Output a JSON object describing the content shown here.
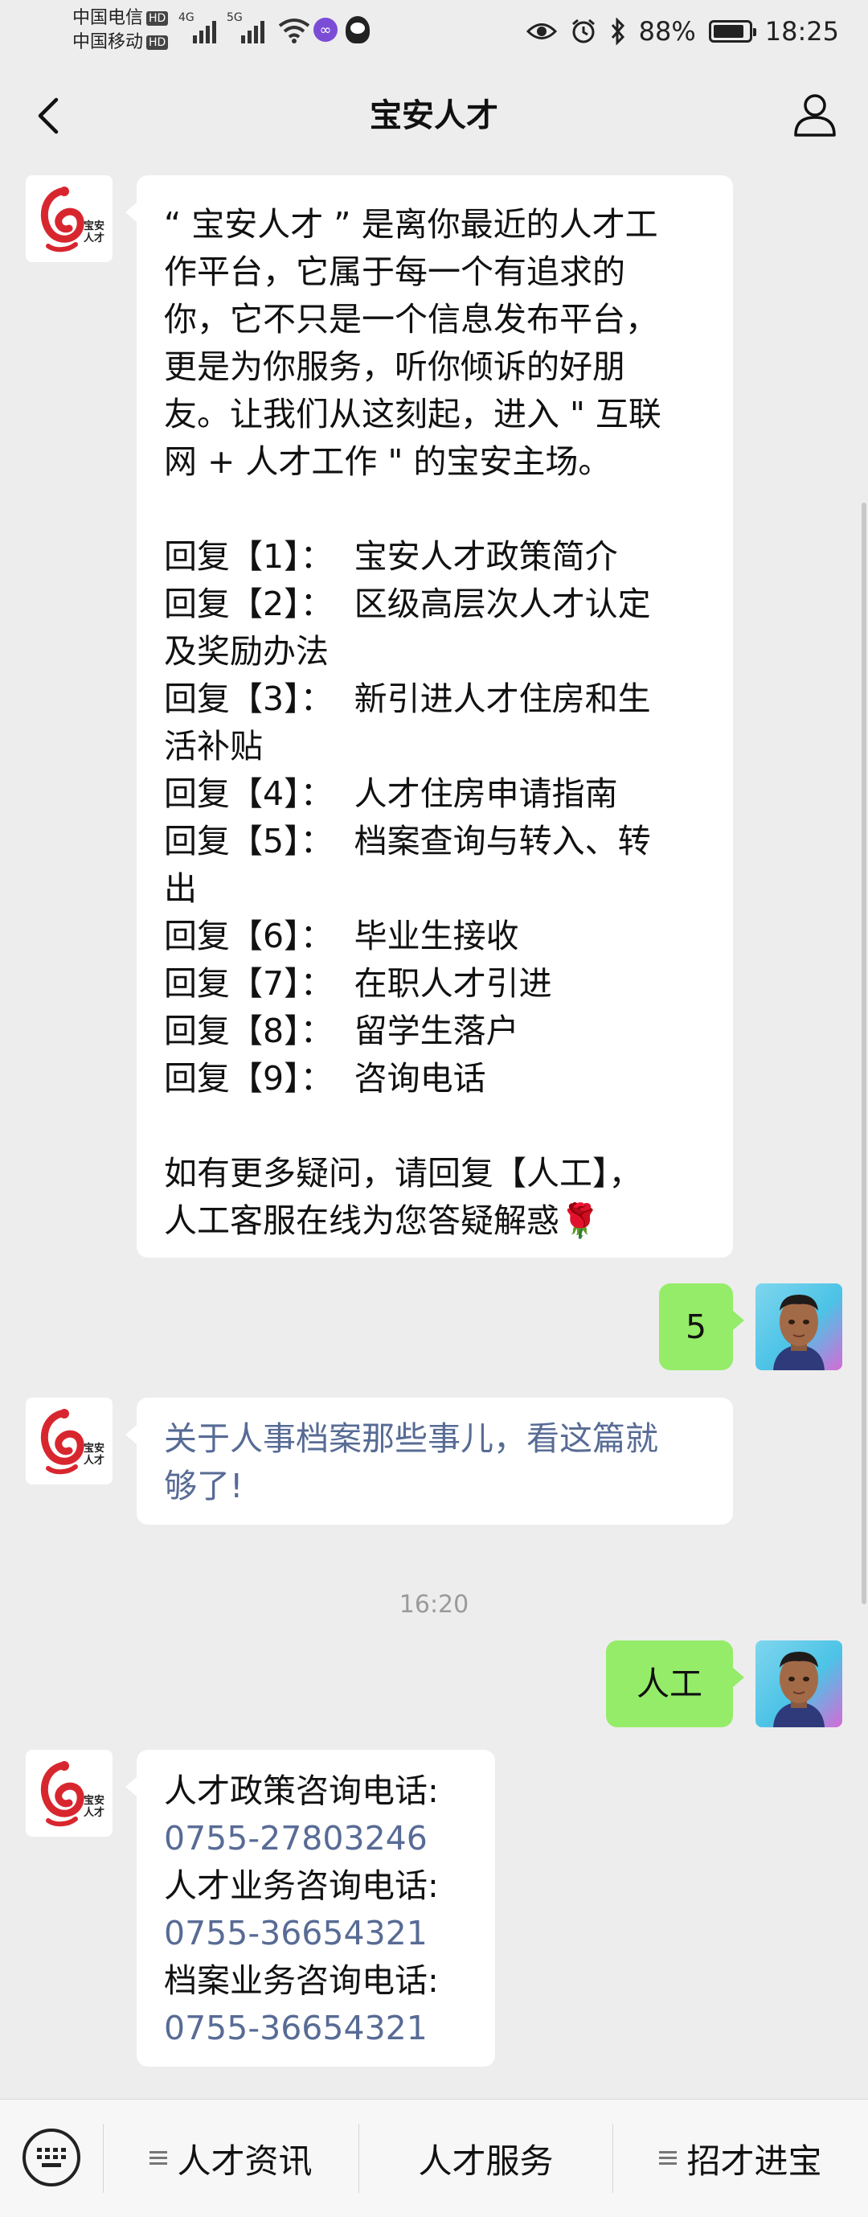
{
  "status_bar": {
    "carrier1": "中国电信",
    "carrier2": "中国移动",
    "hd": "HD",
    "net1": "4G",
    "net2": "5G",
    "battery": "88%",
    "battery_level": 0.88,
    "time": "18:25"
  },
  "nav": {
    "title": "宝安人才"
  },
  "brand": {
    "avatar_text_line1": "宝安",
    "avatar_text_line2": "人才"
  },
  "messages": {
    "intro": {
      "lines": [
        "“ 宝安人才 ” 是离你最近的人才工",
        "作平台，它属于每一个有追求的",
        "你，它不只是一个信息发布平台，",
        "更是为你服务，听你倾诉的好朋",
        "友。让我们从这刻起，进入 \" 互联",
        "网 + 人才工作 \" 的宝安主场。",
        "",
        "回复【1】：  宝安人才政策简介",
        "回复【2】：  区级高层次人才认定",
        "及奖励办法",
        "回复【3】：  新引进人才住房和生",
        "活补贴",
        "回复【4】：  人才住房申请指南",
        "回复【5】：  档案查询与转入、转",
        "出",
        "回复【6】：  毕业生接收",
        "回复【7】：  在职人才引进",
        "回复【8】：  留学生落户",
        "回复【9】：  咨询电话",
        "",
        "如有更多疑问，请回复【人工】，",
        "人工客服在线为您答疑解惑🌹"
      ]
    },
    "reply1": "5",
    "article": {
      "line1": "关于人事档案那些事儿，看这篇就",
      "line2": "够了!"
    },
    "timestamp": "16:20",
    "reply2": "人工",
    "contacts": {
      "label1": "人才政策咨询电话:",
      "phone1": "0755-27803246",
      "label2": "人才业务咨询电话:",
      "phone2": "0755-36654321",
      "label3": "档案业务咨询电话:",
      "phone3": "0755-36654321"
    }
  },
  "menu": {
    "item1": "人才资讯",
    "item2": "人才服务",
    "item3": "招才进宝"
  },
  "colors": {
    "link": "#576b95",
    "green_bubble": "#95ec69",
    "background": "#ededed"
  }
}
